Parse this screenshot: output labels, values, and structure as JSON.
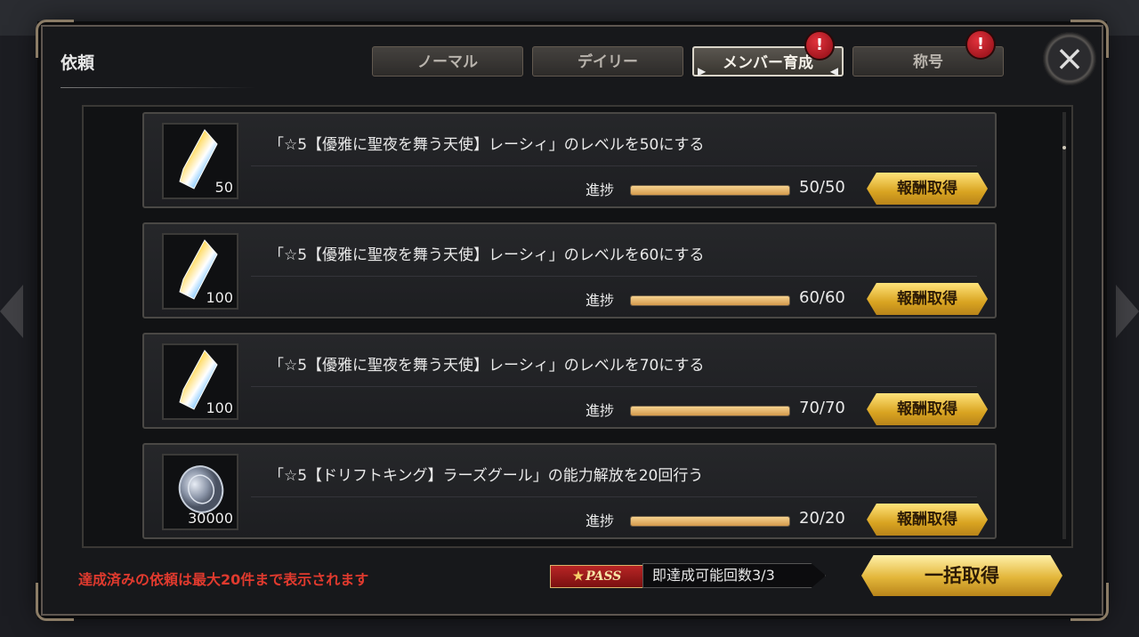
{
  "modal": {
    "title": "依頼",
    "tabs": [
      {
        "label": "ノーマル",
        "active": false,
        "alert": false
      },
      {
        "label": "デイリー",
        "active": false,
        "alert": false
      },
      {
        "label": "メンバー育成",
        "active": true,
        "alert": true
      },
      {
        "label": "称号",
        "active": false,
        "alert": true
      }
    ],
    "alert_glyph": "!",
    "close_icon": "×"
  },
  "side_buttons": [
    {
      "icon": "helmet-icon",
      "glyph": "♞"
    },
    {
      "icon": "refresh-icon",
      "glyph": "↻"
    }
  ],
  "quests": [
    {
      "description": "「☆5【優雅に聖夜を舞う天使】レーシィ」のレベルを50にする",
      "reward_icon": "crystal-icon",
      "reward_qty": "50",
      "progress_label": "進捗",
      "progress_text": "50/50",
      "progress_fraction": 1.0,
      "claim_label": "報酬取得"
    },
    {
      "description": "「☆5【優雅に聖夜を舞う天使】レーシィ」のレベルを60にする",
      "reward_icon": "crystal-icon",
      "reward_qty": "100",
      "progress_label": "進捗",
      "progress_text": "60/60",
      "progress_fraction": 1.0,
      "claim_label": "報酬取得"
    },
    {
      "description": "「☆5【優雅に聖夜を舞う天使】レーシィ」のレベルを70にする",
      "reward_icon": "crystal-icon",
      "reward_qty": "100",
      "progress_label": "進捗",
      "progress_text": "70/70",
      "progress_fraction": 1.0,
      "claim_label": "報酬取得"
    },
    {
      "description": "「☆5【ドリフトキング】ラーズグール」の能力解放を20回行う",
      "reward_icon": "coin-icon",
      "reward_qty": "30000",
      "progress_label": "進捗",
      "progress_text": "20/20",
      "progress_fraction": 1.0,
      "claim_label": "報酬取得"
    }
  ],
  "footer": {
    "note": "達成済みの依頼は最大20件まで表示されます",
    "pass_label": "PASS",
    "pass_text": "即達成可能回数3/3",
    "bulk_claim_label": "一括取得"
  },
  "colors": {
    "accent_gold": "#d9a421",
    "alert_red": "#e2323c",
    "note_red": "#e03a2e"
  }
}
